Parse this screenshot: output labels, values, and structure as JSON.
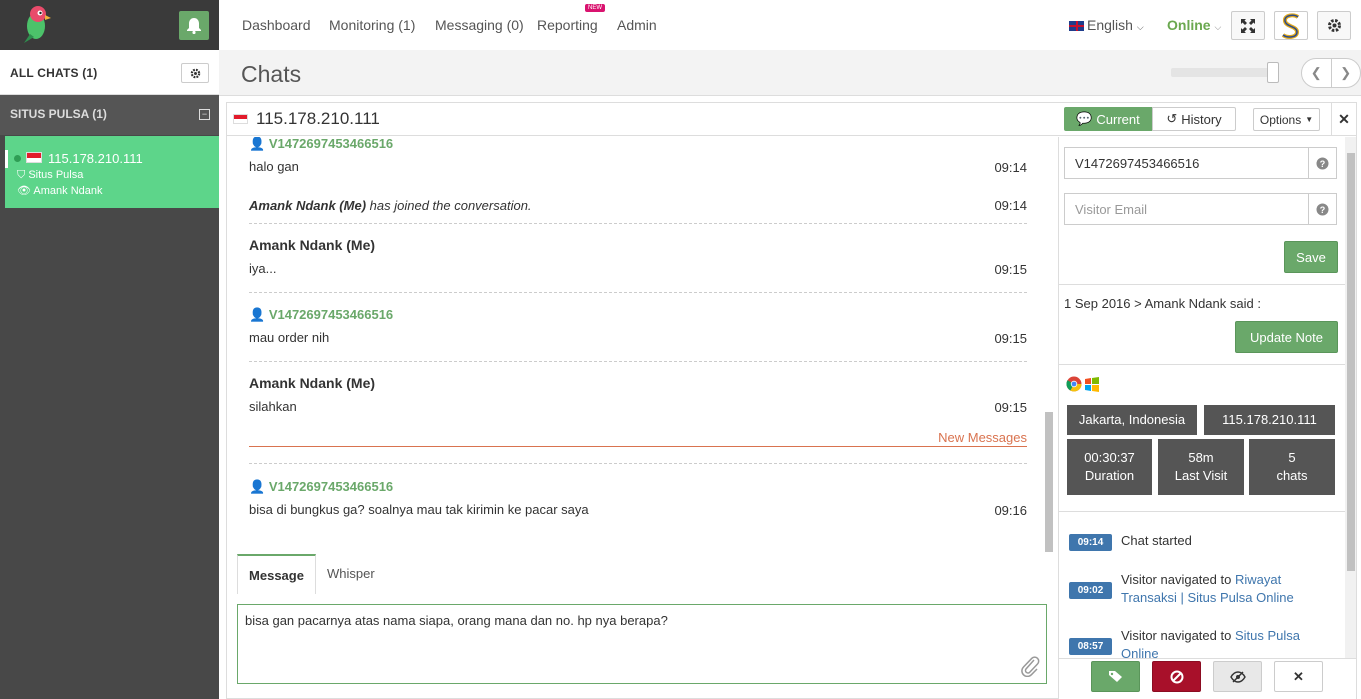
{
  "nav": {
    "items": [
      "Dashboard",
      "Monitoring (1)",
      "Messaging (0)",
      "Reporting",
      "Admin"
    ],
    "new_badge": "NEW",
    "language": "English",
    "status": "Online"
  },
  "sidebar": {
    "all_chats": "ALL CHATS (1)",
    "group": "SITUS PULSA (1)",
    "chat": {
      "ip": "115.178.210.111",
      "site": "Situs Pulsa",
      "operator": "Amank Ndank"
    }
  },
  "header": {
    "title": "Chats"
  },
  "chat": {
    "ip": "115.178.210.111",
    "tabs": {
      "current": "Current",
      "history": "History",
      "options": "Options"
    },
    "messages": [
      {
        "author": "V1472697453466516",
        "type": "visitor",
        "text": "halo gan",
        "time": "09:14"
      },
      {
        "author": "Amank Ndank (Me)",
        "type": "system",
        "text": "has joined the conversation.",
        "time": "09:14"
      },
      {
        "author": "Amank Ndank (Me)",
        "type": "operator",
        "text": "iya...",
        "time": "09:15"
      },
      {
        "author": "V1472697453466516",
        "type": "visitor",
        "text": "mau order nih",
        "time": "09:15"
      },
      {
        "author": "Amank Ndank (Me)",
        "type": "operator",
        "text": "silahkan",
        "time": "09:15"
      },
      {
        "author": "V1472697453466516",
        "type": "visitor",
        "text": "bisa di bungkus ga? soalnya mau tak kirimin ke pacar saya",
        "time": "09:16"
      }
    ],
    "new_messages": "New Messages",
    "composer": {
      "tab_message": "Message",
      "tab_whisper": "Whisper",
      "value": "bisa gan pacarnya atas nama siapa, orang mana dan no. hp nya berapa?"
    }
  },
  "visitor": {
    "name": "V1472697453466516",
    "email_placeholder": "Visitor Email",
    "save": "Save",
    "note": "1 Sep 2016 > Amank Ndank said :",
    "update_note": "Update Note",
    "location": "Jakarta, Indonesia",
    "ip": "115.178.210.111",
    "stats": [
      {
        "value": "00:30:37",
        "label": "Duration"
      },
      {
        "value": "58m",
        "label": "Last Visit"
      },
      {
        "value": "5",
        "label": "chats"
      }
    ],
    "timeline": [
      {
        "time": "09:14",
        "text": "Chat started",
        "link": ""
      },
      {
        "time": "09:02",
        "text": "Visitor navigated to",
        "link": "Riwayat Transaksi | Situs Pulsa Online"
      },
      {
        "time": "08:57",
        "text": "Visitor navigated to",
        "link": "Situs Pulsa Online"
      }
    ]
  },
  "colors": {
    "accent": "#6aa86a",
    "selected_chat": "#5dd58a",
    "danger": "#a8102a",
    "link": "#3f76ad"
  }
}
